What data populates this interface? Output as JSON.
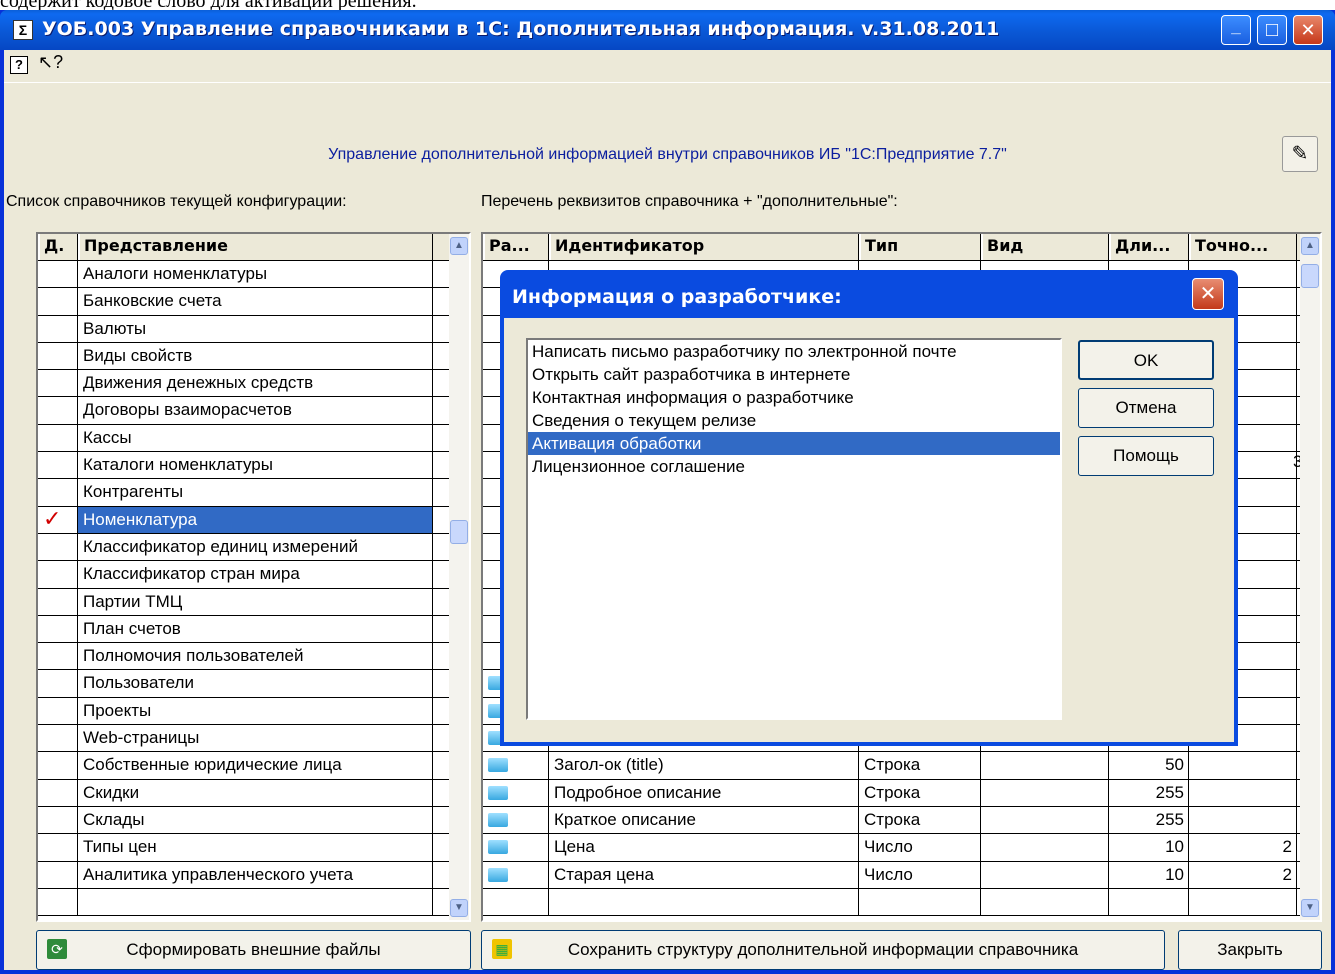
{
  "doc_fragment": "содержит кодовое слово для активации решения.",
  "window": {
    "icon_glyph": "Σ",
    "title": "УОБ.003 Управление справочниками в 1С: Дополнительная информация. v.31.08.2011",
    "min_glyph": "_",
    "max_glyph": "□",
    "close_glyph": "✕"
  },
  "toolbar": {
    "help_glyph": "?",
    "pointer_glyph": "↖?"
  },
  "header": "Управление дополнительной информацией внутри справочников ИБ \"1С:Предприятие 7.7\"",
  "left_label": "Список справочников текущей конфигурации:",
  "right_label": "Перечень реквизитов справочника + \"дополнительные\":",
  "left_grid": {
    "columns": [
      "Д.",
      "Представление"
    ],
    "rows": [
      {
        "flag": "",
        "name": "Аналоги номенклатуры"
      },
      {
        "flag": "",
        "name": "Банковские счета"
      },
      {
        "flag": "",
        "name": "Валюты"
      },
      {
        "flag": "",
        "name": "Виды свойств"
      },
      {
        "flag": "",
        "name": "Движения денежных средств"
      },
      {
        "flag": "",
        "name": "Договоры взаиморасчетов"
      },
      {
        "flag": "",
        "name": "Кассы"
      },
      {
        "flag": "",
        "name": "Каталоги номенклатуры"
      },
      {
        "flag": "",
        "name": "Контрагенты"
      },
      {
        "flag": "✓",
        "name": "Номенклатура"
      },
      {
        "flag": "",
        "name": "Классификатор единиц измерений"
      },
      {
        "flag": "",
        "name": "Классификатор стран мира"
      },
      {
        "flag": "",
        "name": "Партии ТМЦ"
      },
      {
        "flag": "",
        "name": "План счетов"
      },
      {
        "flag": "",
        "name": "Полномочия пользователей"
      },
      {
        "flag": "",
        "name": "Пользователи"
      },
      {
        "flag": "",
        "name": "Проекты"
      },
      {
        "flag": "",
        "name": "Web-страницы"
      },
      {
        "flag": "",
        "name": "Собственные юридические лица"
      },
      {
        "flag": "",
        "name": "Скидки"
      },
      {
        "flag": "",
        "name": "Склады"
      },
      {
        "flag": "",
        "name": "Типы цен"
      },
      {
        "flag": "",
        "name": "Аналитика управленческого учета"
      },
      {
        "flag": "",
        "name": ""
      }
    ]
  },
  "right_grid": {
    "columns": [
      "Ра...",
      "Идентификатор",
      "Тип",
      "Вид",
      "Дли...",
      "Точно..."
    ],
    "visible_rows": [
      {
        "id": "Загол-ок (title)",
        "type": "Строка",
        "kind": "",
        "len": "50",
        "prec": ""
      },
      {
        "id": "Подробное описание",
        "type": "Строка",
        "kind": "",
        "len": "255",
        "prec": ""
      },
      {
        "id": "Краткое описание",
        "type": "Строка",
        "kind": "",
        "len": "255",
        "prec": ""
      },
      {
        "id": "Цена",
        "type": "Число",
        "kind": "",
        "len": "10",
        "prec": "2"
      },
      {
        "id": "Старая цена",
        "type": "Число",
        "kind": "",
        "len": "10",
        "prec": "2"
      }
    ],
    "peek_values": [
      "3"
    ]
  },
  "buttons": {
    "generate": "Сформировать внешние файлы",
    "save": "Сохранить структуру дополнительной информации справочника",
    "close": "Закрыть"
  },
  "dialog": {
    "title": "Информация о разработчике:",
    "close_glyph": "✕",
    "items": [
      "Написать письмо разработчику по электронной почте",
      "Открыть сайт разработчика в интернете",
      "Контактная информация о разработчике",
      "Сведения о текущем релизе",
      "Активация обработки",
      "Лицензионное соглашение"
    ],
    "selected_index": 4,
    "buttons": {
      "ok": "OK",
      "cancel": "Отмена",
      "help": "Помощь"
    }
  },
  "colors": {
    "selection": "#316ac5",
    "title_blue": "#0a58d6",
    "check_red": "#d10000",
    "face": "#ece9d8"
  }
}
